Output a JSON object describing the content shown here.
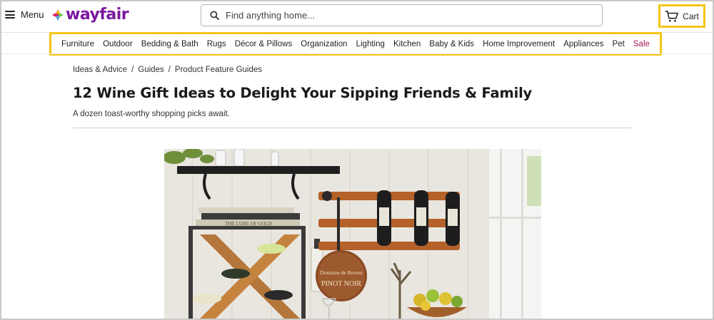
{
  "header": {
    "menu_label": "Menu",
    "logo_text": "wayfair",
    "search_placeholder": "Find anything home...",
    "cart_label": "Cart"
  },
  "nav": {
    "items": [
      "Furniture",
      "Outdoor",
      "Bedding & Bath",
      "Rugs",
      "Décor & Pillows",
      "Organization",
      "Lighting",
      "Kitchen",
      "Baby & Kids",
      "Home Improvement",
      "Appliances",
      "Pet",
      "Sale"
    ]
  },
  "breadcrumb": {
    "items": [
      "Ideas & Advice",
      "Guides",
      "Product Feature Guides"
    ],
    "separator": "/"
  },
  "article": {
    "title": "12 Wine Gift Ideas to Delight Your Sipping Friends & Family",
    "subtitle": "A dozen toast-worthy shopping picks await."
  },
  "hero": {
    "book_text": "THE LURE OF GOLD",
    "sign_line1": "Domaine de Revers",
    "sign_line2": "PINOT NOIR"
  },
  "colors": {
    "brand": "#7b189f",
    "highlight": "#f5c518",
    "sale": "#a3185c"
  },
  "icons": {
    "menu": "hamburger-icon",
    "search": "search-icon",
    "cart": "cart-icon"
  }
}
